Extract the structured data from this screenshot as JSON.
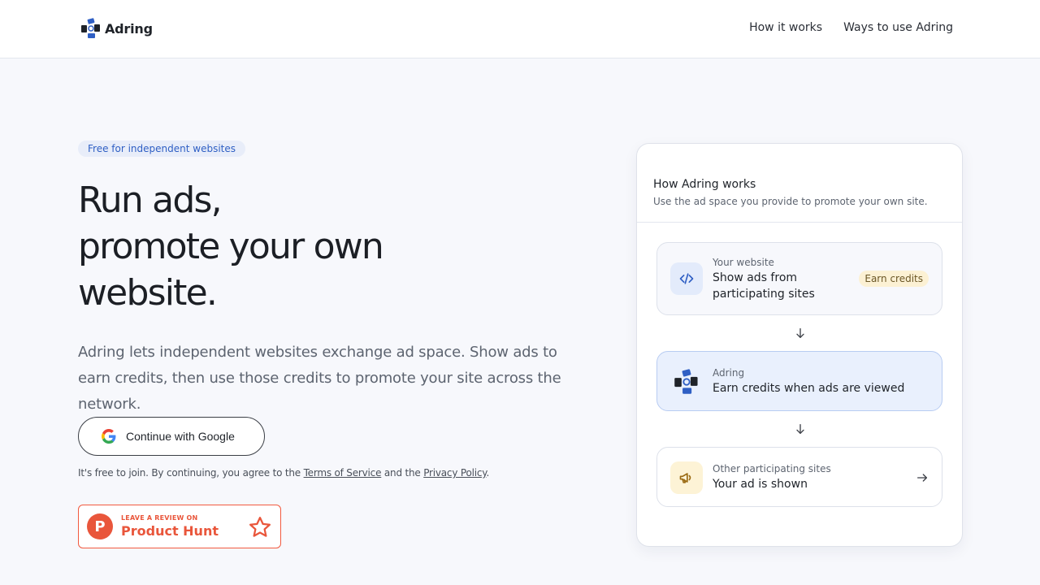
{
  "header": {
    "logo_text": "Adring",
    "nav": [
      "How it works",
      "Ways to use Adring"
    ]
  },
  "hero": {
    "badge": "Free for independent websites",
    "title_lines": [
      "Run ads,",
      "promote your own",
      "website."
    ],
    "subtitle": "Adring lets independent websites exchange ad space. Show ads to earn credits, then use those credits to promote your site across the network.",
    "cta": "Continue with Google",
    "terms": {
      "prefix": "It's free to join. By continuing, you agree to the ",
      "tos": "Terms of Service",
      "middle": " and the ",
      "privacy": "Privacy Policy",
      "suffix": "."
    },
    "product_hunt": {
      "small": "LEAVE A REVIEW ON",
      "big": "Product Hunt",
      "letter": "P"
    }
  },
  "card": {
    "title": "How Adring works",
    "subtitle": "Use the ad space you provide to promote your own site.",
    "steps": [
      {
        "label": "Your website",
        "main": "Show ads from participating sites",
        "pill": "Earn credits",
        "icon": "code-icon"
      },
      {
        "label": "Adring",
        "main": "Earn credits when ads are viewed",
        "icon": "adring-logo-icon"
      },
      {
        "label": "Other participating sites",
        "main": "Your ad is shown",
        "icon": "megaphone-icon"
      }
    ]
  },
  "colors": {
    "accent": "#2f5fc4",
    "product_hunt": "#e9563b",
    "background": "#f7f8fc"
  }
}
